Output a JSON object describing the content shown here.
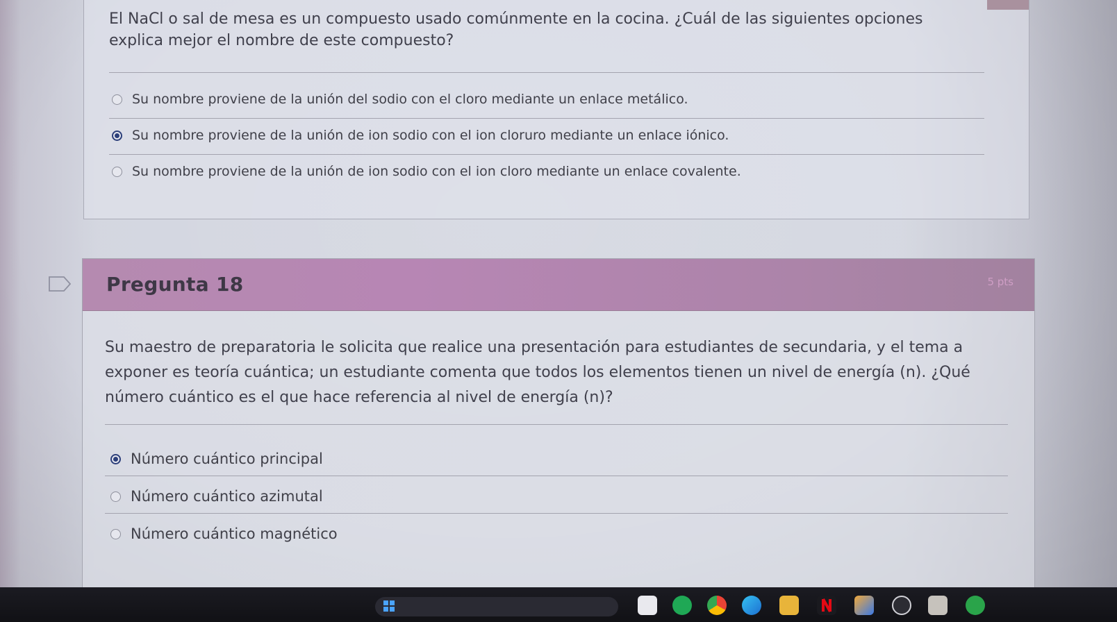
{
  "question17": {
    "text": "El NaCl o sal de mesa es un compuesto usado comúnmente en la cocina. ¿Cuál de las siguientes opciones explica mejor el nombre de este compuesto?",
    "options": [
      {
        "label": "Su nombre proviene de la unión del sodio con el cloro mediante un enlace metálico.",
        "selected": false
      },
      {
        "label": "Su nombre proviene de la unión de ion sodio con el ion cloruro mediante un enlace iónico.",
        "selected": true
      },
      {
        "label": "Su nombre proviene de la unión de ion sodio con el ion cloro mediante un enlace covalente.",
        "selected": false
      }
    ]
  },
  "question18": {
    "title": "Pregunta 18",
    "points": "5 pts",
    "text": "Su maestro de preparatoria le solicita que realice una presentación para estudiantes de secundaria, y el tema a exponer es teoría cuántica; un estudiante comenta que todos los elementos tienen un nivel de energía (n). ¿Qué número cuántico es el que hace referencia al nivel de energía (n)?",
    "options": [
      {
        "label": "Número cuántico principal",
        "selected": true
      },
      {
        "label": "Número cuántico azimutal",
        "selected": false
      },
      {
        "label": "Número cuántico magnético",
        "selected": false
      }
    ]
  },
  "icons": {
    "flag": "flag-outline-icon",
    "radio_unchecked": "radio-unchecked-icon",
    "radio_checked": "radio-checked-icon"
  },
  "colors": {
    "header_purple": "#b786b4",
    "radio_selected": "#2c3f7a",
    "page_background": "#d5d8e1",
    "taskbar": "#16161b"
  },
  "taskbar_icons": [
    "start-menu-icon",
    "search-box",
    "file-explorer-icon",
    "whatsapp-icon",
    "chrome-icon",
    "edge-icon",
    "folder-icon",
    "netflix-icon",
    "app-icon",
    "obs-icon",
    "calendar-icon",
    "xbox-icon"
  ]
}
